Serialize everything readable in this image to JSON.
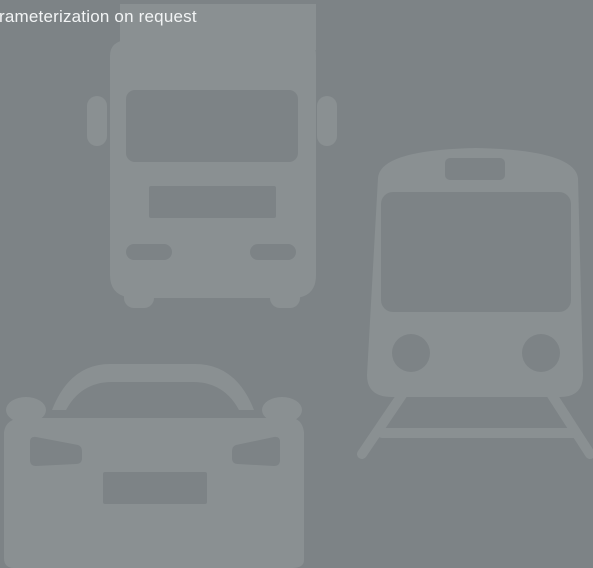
{
  "caption": {
    "text": "rameterization on request"
  },
  "illustration": {
    "icons": [
      "truck-icon",
      "tram-icon",
      "car-icon"
    ],
    "colors": {
      "background": "#7d8386",
      "silhouette": "#8a9092",
      "caption_text": "#f2f4f5"
    }
  }
}
